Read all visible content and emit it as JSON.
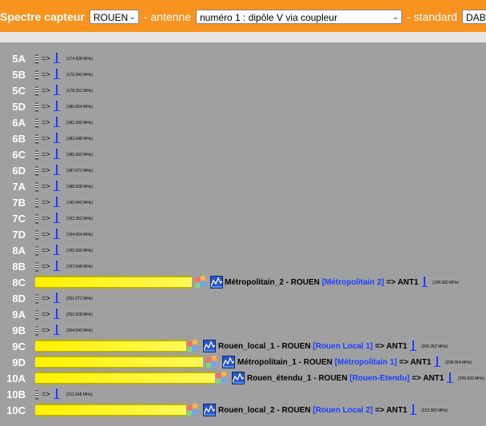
{
  "header": {
    "spectre_label": "Spectre capteur",
    "ville": "ROUEN",
    "antenne_label": "- antenne",
    "antenne": "numéro 1 : dipôle V via coupleur",
    "standard_label": "- standard",
    "standard": "DAB"
  },
  "rows": [
    {
      "label": "5A",
      "freq": "(174.928 MHz)"
    },
    {
      "label": "5B",
      "freq": "(176.640 MHz)"
    },
    {
      "label": "5C",
      "freq": "(178.352 MHz)"
    },
    {
      "label": "5D",
      "freq": "(180.064 MHz)"
    },
    {
      "label": "6A",
      "freq": "(181.936 MHz)"
    },
    {
      "label": "6B",
      "freq": "(183.648 MHz)"
    },
    {
      "label": "6C",
      "freq": "(185.360 MHz)"
    },
    {
      "label": "6D",
      "freq": "(187.072 MHz)"
    },
    {
      "label": "7A",
      "freq": "(188.928 MHz)"
    },
    {
      "label": "7B",
      "freq": "(190.640 MHz)"
    },
    {
      "label": "7C",
      "freq": "(192.352 MHz)"
    },
    {
      "label": "7D",
      "freq": "(194.064 MHz)"
    },
    {
      "label": "8A",
      "freq": "(195.936 MHz)"
    },
    {
      "label": "8B",
      "freq": "(197.648 MHz)"
    },
    {
      "label": "8C",
      "freq": "(199.360 MHz)",
      "service": "Métropolitain_2 - ROUEN",
      "ensemble": "[Métropolitain 2]",
      "ant": "=> ANT1"
    },
    {
      "label": "8D",
      "freq": "(201.072 MHz)"
    },
    {
      "label": "9A",
      "freq": "(202.928 MHz)"
    },
    {
      "label": "9B",
      "freq": "(204.640 MHz)"
    },
    {
      "label": "9C",
      "freq": "(206.352 MHz)",
      "service": "Rouen_local_1 - ROUEN",
      "ensemble": "[Rouen Local 1]",
      "ant": "=> ANT1"
    },
    {
      "label": "9D",
      "freq": "(208.064 MHz)",
      "service": "Métropolitain_1 - ROUEN",
      "ensemble": "[Métropolitain 1]",
      "ant": "=> ANT1"
    },
    {
      "label": "10A",
      "freq": "(209.936 MHz)",
      "service": "Rouen_étendu_1 - ROUEN",
      "ensemble": "[Rouen-Etendu]",
      "ant": "=> ANT1"
    },
    {
      "label": "10B",
      "freq": "(211.648 MHz)"
    },
    {
      "label": "10C",
      "freq": "(213.360 MHz)",
      "service": "Rouen_local_2 - ROUEN",
      "ensemble": "[Rouen Local 2]",
      "ant": "=> ANT1"
    }
  ],
  "arrow": "=>"
}
